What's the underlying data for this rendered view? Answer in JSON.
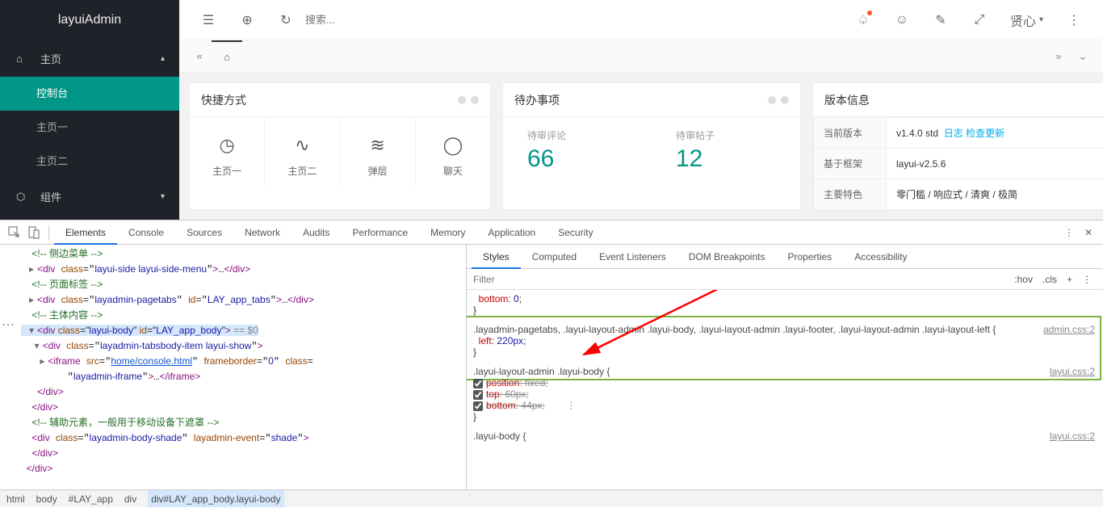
{
  "sidebar": {
    "logo": "layuiAdmin",
    "home": "主页",
    "items": [
      "控制台",
      "主页一",
      "主页二"
    ],
    "component": "组件"
  },
  "header": {
    "search_ph": "搜索...",
    "user": "贤心"
  },
  "cards": {
    "quick": {
      "title": "快捷方式",
      "cells": [
        "主页一",
        "主页二",
        "弹层",
        "聊天"
      ]
    },
    "todo": {
      "title": "待办事项",
      "cells": [
        {
          "label": "待审评论",
          "num": "66"
        },
        {
          "label": "待审帖子",
          "num": "12"
        }
      ]
    },
    "ver": {
      "title": "版本信息",
      "rows": [
        {
          "k": "当前版本",
          "v": "v1.4.0 std",
          "links": [
            "日志",
            "检查更新"
          ]
        },
        {
          "k": "基于框架",
          "v": "layui-v2.5.6"
        },
        {
          "k": "主要特色",
          "v": "零门槛 / 响应式 / 清爽 / 极简"
        }
      ]
    }
  },
  "devtools": {
    "tabs": [
      "Elements",
      "Console",
      "Sources",
      "Network",
      "Audits",
      "Performance",
      "Memory",
      "Application",
      "Security"
    ],
    "style_tabs": [
      "Styles",
      "Computed",
      "Event Listeners",
      "DOM Breakpoints",
      "Properties",
      "Accessibility"
    ],
    "filter_ph": "Filter",
    "hov": ":hov",
    "cls": ".cls",
    "dom": {
      "c1": "<!-- 侧边菜单 -->",
      "l1a": "<div class=\"",
      "l1b": "layui-side layui-side-menu",
      "l1c": "\">…</div>",
      "c2": "<!-- 页面标签 -->",
      "l2a": "<div class=\"",
      "l2b": "layadmin-pagetabs",
      "l2c": "\" id=\"",
      "l2d": "LAY_app_tabs",
      "l2e": "\">…</div>",
      "c3": "<!-- 主体内容 -->",
      "l3a": "<div class=\"",
      "l3b": "layui-body",
      "l3c": "\" id=\"",
      "l3d": "LAY_app_body",
      "l3e": "\"> == $0",
      "l4a": "<div class=\"",
      "l4b": "layadmin-tabsbody-item layui-show",
      "l4c": "\">",
      "l5a": "<iframe src=\"",
      "l5b": "home/console.html",
      "l5c": "\" frameborder=\"",
      "l5d": "0",
      "l5e": "\" class=\"",
      "l5f": "layadmin-iframe",
      "l5g": "\">…</iframe>",
      "l6": "</div>",
      "l7": "</div>",
      "c4": "<!-- 辅助元素，一般用于移动设备下遮罩 -->",
      "l8a": "<div class=\"",
      "l8b": "layadmin-body-shade",
      "l8c": "\" layadmin-event=\"",
      "l8d": "shade",
      "l8e": "\">",
      "l8f": "</div>",
      "l9": "</div>"
    },
    "styles": {
      "r0a": "bottom",
      "r0b": "0",
      "r1sel": ".layadmin-pagetabs, .layui-layout-admin .layui-body, .layui-layout-admin .layui-footer, .layui-layout-admin .layui-layout-left {",
      "r1p": "left",
      "r1v": "220px",
      "r1src": "admin.css:2",
      "r2sel": ".layui-layout-admin .layui-body {",
      "r2p1": "position",
      "r2v1": "fixed",
      "r2p2": "top",
      "r2v2": "60px",
      "r2p3": "bottom",
      "r2v3": "44px",
      "r2src": "layui.css:2",
      "r3sel": ".layui-body {",
      "r3src": "layui.css:2"
    },
    "crumb": [
      "html",
      "body",
      "#LAY_app",
      "div",
      "div#LAY_app_body.layui-body"
    ]
  }
}
